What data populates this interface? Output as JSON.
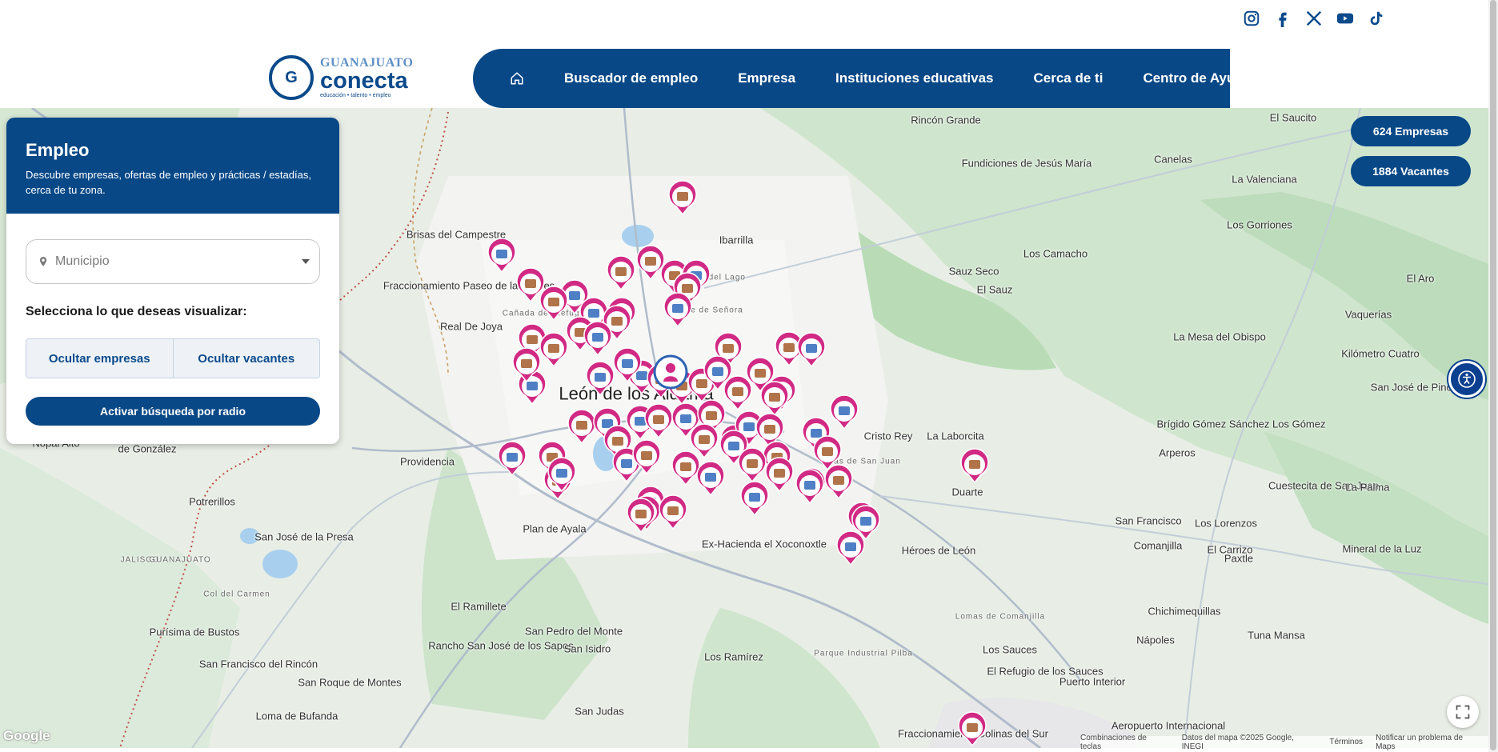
{
  "social": [
    {
      "name": "instagram-icon"
    },
    {
      "name": "facebook-icon"
    },
    {
      "name": "x-icon"
    },
    {
      "name": "youtube-icon"
    },
    {
      "name": "tiktok-icon"
    }
  ],
  "logo": {
    "line1": "GUANAJUATO",
    "line2": "conecta",
    "tagline": "educación • talento • empleo"
  },
  "nav": {
    "home_icon": "home-icon",
    "items": [
      "Buscador de empleo",
      "Empresa",
      "Instituciones educativas",
      "Cerca de ti",
      "Centro de Ayuda"
    ]
  },
  "panel": {
    "title": "Empleo",
    "description": "Descubre empresas, ofertas de empleo y prácticas / estadías, cerca de tu zona.",
    "municipio_placeholder": "Municipio",
    "select_label": "Selecciona lo que deseas visualizar:",
    "hide_companies": "Ocultar empresas",
    "hide_vacancies": "Ocultar vacantes",
    "radius_button": "Activar búsqueda por radio"
  },
  "counters": {
    "empresas": "624 Empresas",
    "vacantes": "1884 Vacantes"
  },
  "map": {
    "brand": "Google",
    "attribution": [
      "Combinaciones de teclas",
      "Datos del mapa ©2025 Google, INEGI",
      "Términos",
      "Notificar un problema de Maps"
    ],
    "labels": [
      "Rincón Grande",
      "El Saucito",
      "Fundiciones de Jesús María",
      "Canelas",
      "La Valenciana",
      "Los Gorriones",
      "Brisas del Campestre",
      "Ibarrilla",
      "Los Camacho",
      "Sauz Seco",
      "El Sauz",
      "El Aro",
      "Fraccionamiento Paseo de las Torres",
      "Real De Joya",
      "Vaquerías",
      "La Mesa del Obispo",
      "Kilómetro Cuatro",
      "San José de Pinos",
      "León de los Aldama",
      "Brígido Gómez Sánchez Los Gómez",
      "Cristo Rey",
      "La Laborcita",
      "Providencia",
      "Nopal Alto",
      "de González",
      "Arperos",
      "Cuestecita de San Juan",
      "La Palma",
      "Duarte",
      "Potrerillos",
      "San José de la Presa",
      "Plan de Ayala",
      "Ex-Hacienda el Xoconoxtle",
      "Héroes de León",
      "San Francisco",
      "Comanjilla",
      "Los Lorenzos",
      "Paxtle",
      "El Carrizo",
      "Mineral de la Luz",
      "El Ramillete",
      "Chichimequillas",
      "Rancho San José de los Sapos",
      "San Pedro del Monte",
      "San Isidro",
      "Purísima de Bustos",
      "Nápoles",
      "Tuna Mansa",
      "San Francisco del Rincón",
      "Los Ramírez",
      "Los Sauces",
      "El Refugio de los Sauces",
      "San Roque de Montes",
      "Puerto Interior",
      "Loma de Bufanda",
      "San Judas",
      "Aeropuerto Internacional",
      "Fraccionamiento Colinas del Sur",
      "JALISCO",
      "GUANAJUATO",
      "Pilas de San Juan",
      "Lomas de Comanjilla",
      "Parque Industrial Pilba",
      "Col del Carmen",
      "Cañada del Refugio",
      "Valle de Señora",
      "Brisas del Lago"
    ]
  }
}
